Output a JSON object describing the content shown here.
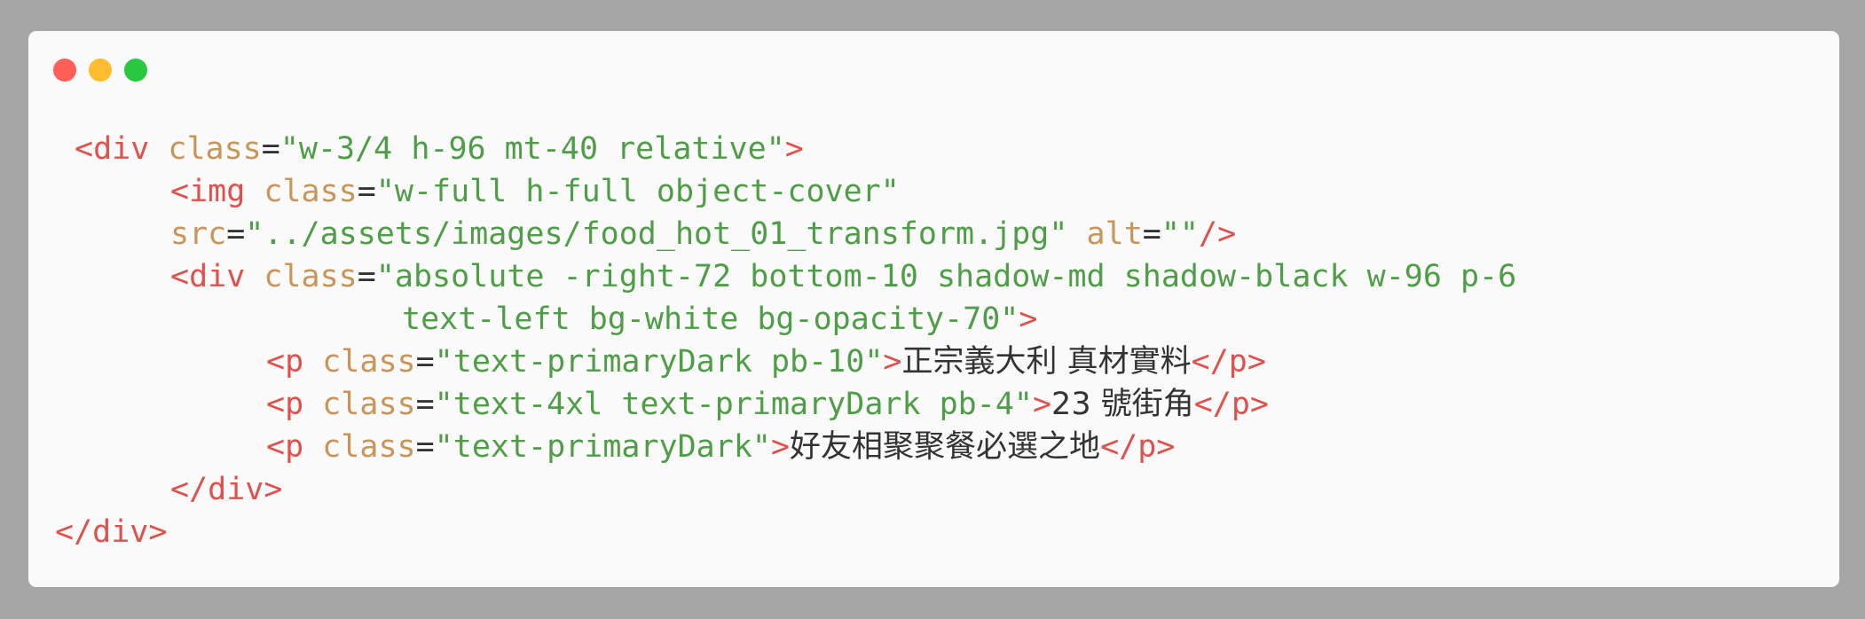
{
  "window": {
    "controls": [
      "close",
      "minimize",
      "zoom"
    ],
    "colors": {
      "close": "#ff5f57",
      "minimize": "#febc2e",
      "zoom": "#28c840"
    }
  },
  "code": {
    "colors": {
      "tag": "#e0504c",
      "attr": "#c8955a",
      "string": "#4f9d47",
      "text": "#333333"
    },
    "l1": {
      "open": "<div",
      "attr": "class",
      "eq": "=",
      "val": "\"w-3/4 h-96 mt-40 relative\"",
      "close": ">"
    },
    "l2": {
      "open": "<img",
      "attr": "class",
      "eq": "=",
      "val": "\"w-full h-full object-cover\""
    },
    "l3": {
      "attr": "src",
      "eq": "=",
      "val": "\"../assets/images/food_hot_01_transform.jpg\"",
      "attr2": "alt",
      "eq2": "=",
      "val2": "\"\"",
      "close": "/>"
    },
    "l4": {
      "open": "<div",
      "attr": "class",
      "eq": "=",
      "val": "\"absolute -right-72 bottom-10 shadow-md shadow-black w-96 p-6"
    },
    "l5": {
      "val": "text-left bg-white bg-opacity-70\"",
      "close": ">"
    },
    "l6": {
      "open": "<p",
      "attr": "class",
      "eq": "=",
      "val": "\"text-primaryDark pb-10\"",
      "close": ">",
      "text": "正宗義大利 真材實料",
      "end": "</p>"
    },
    "l7": {
      "open": "<p",
      "attr": "class",
      "eq": "=",
      "val": "\"text-4xl text-primaryDark pb-4\"",
      "close": ">",
      "text": "23 號街角",
      "end": "</p>"
    },
    "l8": {
      "open": "<p",
      "attr": "class",
      "eq": "=",
      "val": "\"text-primaryDark\"",
      "close": ">",
      "text": "好友相聚聚餐必選之地",
      "end": "</p>"
    },
    "l9": {
      "end": "</div>"
    },
    "l10": {
      "end": "</div>"
    }
  }
}
